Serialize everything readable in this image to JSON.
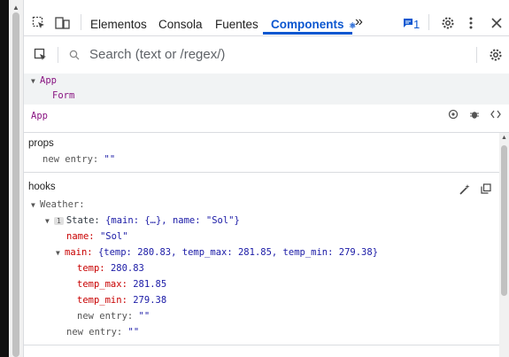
{
  "toolbar": {
    "tabs": [
      "Elementos",
      "Consola",
      "Fuentes",
      "Components"
    ],
    "active_tab": "Components",
    "more_label": "»",
    "issues_count": "1",
    "accent": "#0b57d0"
  },
  "search": {
    "placeholder": "Search (text or /regex/)"
  },
  "tree": {
    "items": [
      {
        "label": "App"
      },
      {
        "label": "Form"
      }
    ]
  },
  "selected": {
    "name": "App"
  },
  "props": {
    "title": "props",
    "new_entry_key": "new entry:",
    "new_entry_value": "\"\""
  },
  "hooks": {
    "title": "hooks",
    "weather_label": "Weather:",
    "state_index": "1",
    "state_label": "State:",
    "state_preview": "{main: {…}, name: \"Sol\"}",
    "name_key": "name:",
    "name_value": "\"Sol\"",
    "main_key": "main:",
    "main_preview": "{temp: 280.83, temp_max: 281.85, temp_min: 279.38}",
    "temp_key": "temp:",
    "temp_value": "280.83",
    "temp_max_key": "temp_max:",
    "temp_max_value": "281.85",
    "temp_min_key": "temp_min:",
    "temp_min_value": "279.38",
    "inner_new_entry_key": "new entry:",
    "inner_new_entry_value": "\"\"",
    "outer_new_entry_key": "new entry:",
    "outer_new_entry_value": "\"\""
  }
}
